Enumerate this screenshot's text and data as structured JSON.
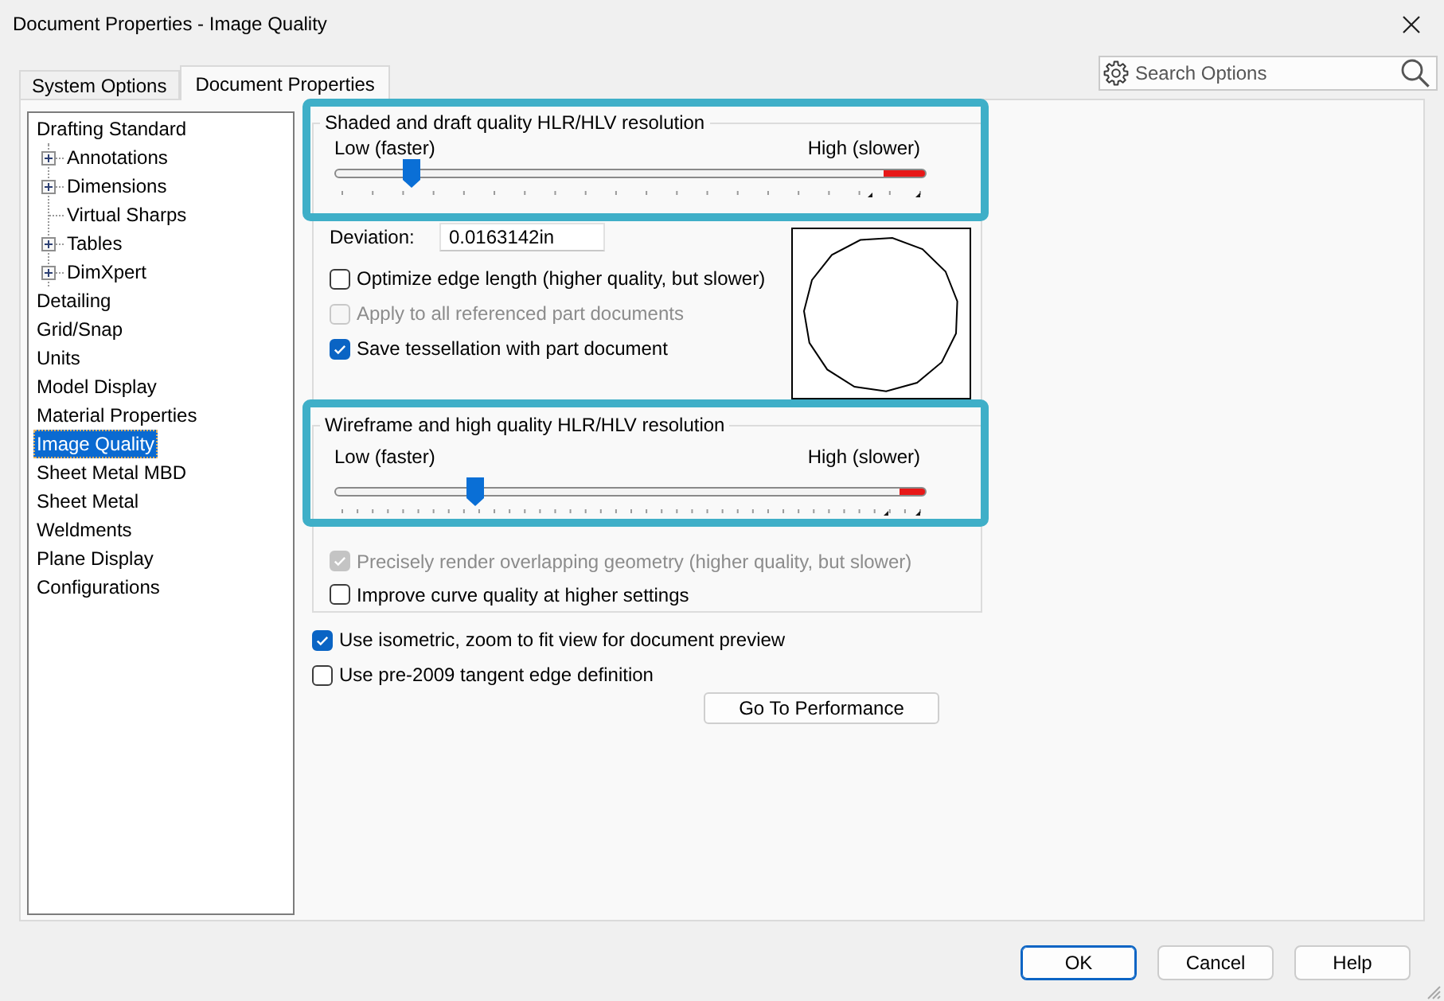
{
  "window": {
    "title": "Document Properties - Image Quality"
  },
  "tabs": [
    {
      "label": "System Options",
      "selected": false
    },
    {
      "label": "Document Properties",
      "selected": true
    }
  ],
  "search": {
    "placeholder": "Search Options"
  },
  "tree": [
    {
      "label": "Drafting Standard",
      "selected": false,
      "children": [
        {
          "label": "Annotations",
          "kind": "branch",
          "expanded": false,
          "selected": false
        },
        {
          "label": "Dimensions",
          "kind": "branch",
          "expanded": false,
          "selected": false
        },
        {
          "label": "Virtual Sharps",
          "kind": "leaf",
          "selected": false
        },
        {
          "label": "Tables",
          "kind": "branch",
          "expanded": false,
          "selected": false
        },
        {
          "label": "DimXpert",
          "kind": "branch",
          "expanded": false,
          "selected": false
        }
      ]
    },
    {
      "label": "Detailing",
      "selected": false
    },
    {
      "label": "Grid/Snap",
      "selected": false
    },
    {
      "label": "Units",
      "selected": false
    },
    {
      "label": "Model Display",
      "selected": false
    },
    {
      "label": "Material Properties",
      "selected": false
    },
    {
      "label": "Image Quality",
      "selected": true
    },
    {
      "label": "Sheet Metal MBD",
      "selected": false
    },
    {
      "label": "Sheet Metal",
      "selected": false
    },
    {
      "label": "Weldments",
      "selected": false
    },
    {
      "label": "Plane Display",
      "selected": false
    },
    {
      "label": "Configurations",
      "selected": false
    }
  ],
  "groups": [
    {
      "title": "Shaded and draft quality HLR/HLV resolution",
      "highlighted": true,
      "slider": {
        "kind": "coarse",
        "low_label": "Low (faster)",
        "high_label": "High (slower)",
        "level": 0.12
      },
      "deviation": {
        "label": "Deviation:",
        "value": "0.0163142in"
      },
      "checkboxes": [
        {
          "label": "Optimize edge length (higher quality, but slower)",
          "checked": false,
          "disabled": false
        },
        {
          "label": "Apply to all referenced part documents",
          "checked": false,
          "disabled": true
        },
        {
          "label": "Save tessellation with part document",
          "checked": true,
          "disabled": false
        }
      ]
    },
    {
      "title": "Wireframe and high quality HLR/HLV resolution",
      "highlighted": true,
      "slider": {
        "kind": "fine",
        "low_label": "Low (faster)",
        "high_label": "High (slower)",
        "level": 0.23
      },
      "checkboxes": [
        {
          "label": "Precisely render overlapping geometry (higher quality, but slower)",
          "checked": true,
          "disabled": true
        },
        {
          "label": "Improve curve quality at higher settings",
          "checked": false,
          "disabled": false
        }
      ]
    }
  ],
  "options": [
    {
      "label": "Use isometric, zoom to fit view for document preview",
      "checked": true,
      "disabled": false
    },
    {
      "label": "Use pre-2009 tangent edge definition",
      "checked": false,
      "disabled": false
    }
  ],
  "performance_button": {
    "label": "Go To Performance"
  },
  "buttons": [
    {
      "label": "OK",
      "default": true
    },
    {
      "label": "Cancel",
      "default": false
    },
    {
      "label": "Help",
      "default": false
    }
  ]
}
